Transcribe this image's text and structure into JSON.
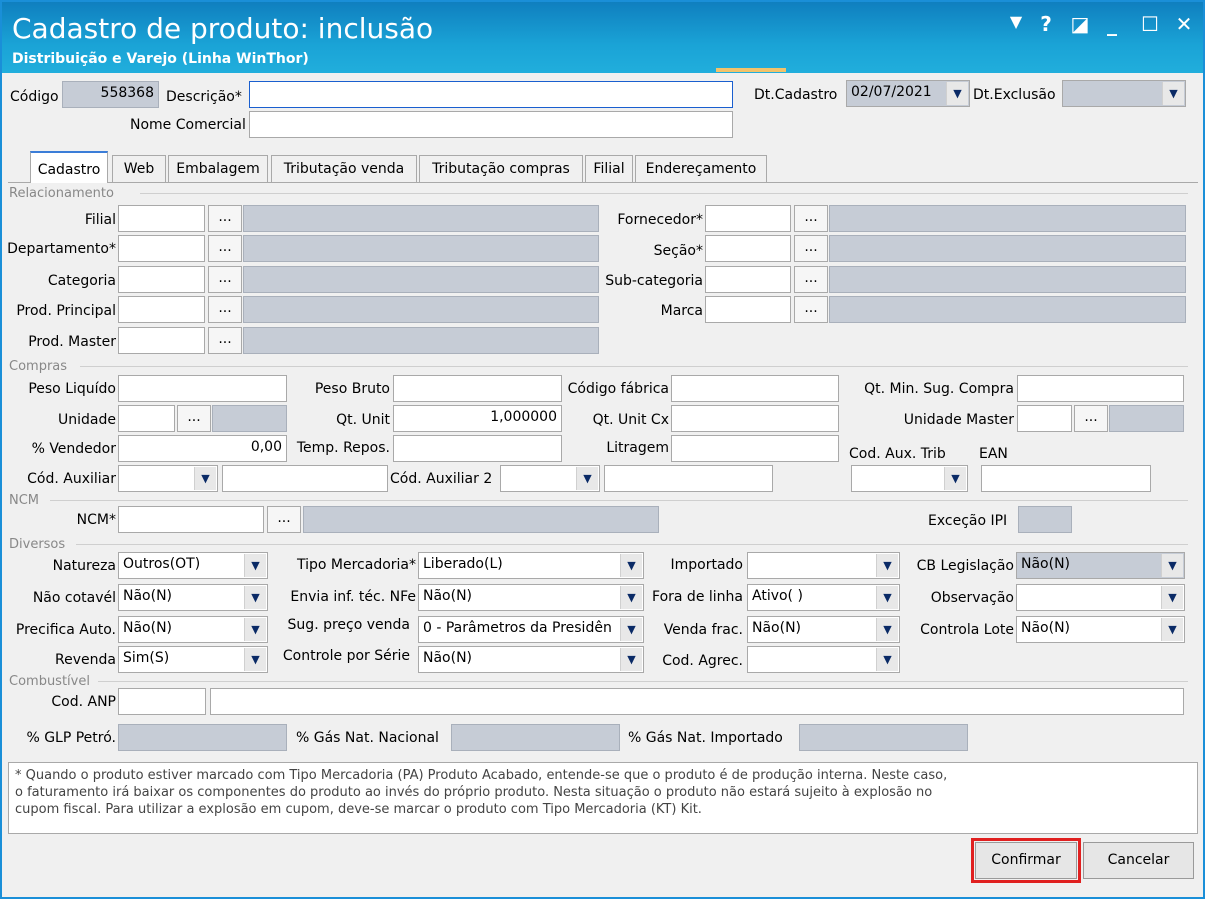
{
  "window": {
    "title": "Cadastro de produto: inclusão",
    "subtitle": "Distribuição e Varejo (Linha WinThor)",
    "controls": {
      "dropdown": "▼",
      "help": "?",
      "restore": "◪",
      "minimize": "_",
      "maximize": "☐",
      "close": "✕"
    }
  },
  "header": {
    "codigo_label": "Código",
    "codigo_value": "558368",
    "descricao_label": "Descrição*",
    "descricao_value": "",
    "nome_comercial_label": "Nome Comercial",
    "dt_cadastro_label": "Dt.Cadastro",
    "dt_cadastro_value": "02/07/2021",
    "dt_exclusao_label": "Dt.Exclusão",
    "dt_exclusao_value": ""
  },
  "tabs": [
    "Cadastro",
    "Web",
    "Embalagem",
    "Tributação venda",
    "Tributação compras",
    "Filial",
    "Endereçamento"
  ],
  "ellipsis": "...",
  "relacionamento": {
    "section": "Relacionamento",
    "filial": "Filial",
    "departamento": "Departamento*",
    "categoria": "Categoria",
    "prod_principal": "Prod. Principal",
    "prod_master": "Prod. Master",
    "fornecedor": "Fornecedor*",
    "secao": "Seção*",
    "subcategoria": "Sub-categoria",
    "marca": "Marca"
  },
  "compras": {
    "section": "Compras",
    "peso_liquido": "Peso Liquído",
    "peso_bruto": "Peso Bruto",
    "codigo_fabrica": "Código fábrica",
    "qt_min": "Qt. Min. Sug. Compra",
    "unidade": "Unidade",
    "qt_unit": "Qt. Unit",
    "qt_unit_value": "1,000000",
    "qt_unit_cx": "Qt. Unit Cx",
    "unidade_master": "Unidade Master",
    "vendedor": "% Vendedor",
    "vendedor_value": "0,00",
    "temp_repos": "Temp. Repos.",
    "litragem": "Litragem",
    "cod_aux_trib": "Cod. Aux. Trib",
    "ean": "EAN",
    "cod_auxiliar": "Cód. Auxiliar",
    "cod_auxiliar2": "Cód. Auxiliar 2"
  },
  "ncm": {
    "section": "NCM",
    "ncm_label": "NCM*",
    "excecao_ipi": "Exceção IPI"
  },
  "diversos": {
    "section": "Diversos",
    "natureza": "Natureza",
    "natureza_value": "Outros(OT)",
    "tipo_mercadoria": "Tipo Mercadoria*",
    "tipo_mercadoria_value": "Liberado(L)",
    "importado": "Importado",
    "importado_value": "",
    "cb_legislacao": "CB Legislação",
    "cb_legislacao_value": "Não(N)",
    "nao_cotavel": "Não cotavél",
    "nao_cotavel_value": "Não(N)",
    "envia_inf": "Envia inf. téc. NFe",
    "envia_inf_value": "Não(N)",
    "fora_linha": "Fora de linha",
    "fora_linha_value": "Ativo( )",
    "observacao": "Observação",
    "observacao_value": "",
    "precifica": "Precifica Auto.",
    "precifica_value": "Não(N)",
    "sug_preco": "Sug. preço venda",
    "sug_preco_value": "0 - Parâmetros da Presidên",
    "venda_frac": "Venda frac.",
    "venda_frac_value": "Não(N)",
    "controla_lote": "Controla Lote",
    "controla_lote_value": "Não(N)",
    "revenda": "Revenda",
    "revenda_value": "Sim(S)",
    "controle_serie": "Controle por Série",
    "controle_serie_value": "Não(N)",
    "cod_agrec": "Cod. Agrec.",
    "cod_agrec_value": ""
  },
  "combustivel": {
    "section": "Combustível",
    "cod_anp": "Cod. ANP",
    "glp": "% GLP Petró.",
    "gas_nac": "% Gás Nat. Nacional",
    "gas_imp": "% Gás Nat. Importado"
  },
  "note": {
    "line1": "* Quando o produto estiver marcado com Tipo Mercadoria (PA) Produto Acabado, entende-se que o produto é de produção interna. Neste caso,",
    "line2": "o faturamento irá baixar os componentes do produto ao invés do próprio produto. Nesta situação o produto não estará sujeito à explosão no",
    "line3": "cupom fiscal. Para utilizar a explosão em cupom, deve-se marcar o produto com Tipo Mercadoria (KT) Kit."
  },
  "buttons": {
    "confirmar": "Confirmar",
    "cancelar": "Cancelar"
  },
  "colors": {
    "titlebar": "#1aa3d6",
    "highlight": "#e02020"
  }
}
